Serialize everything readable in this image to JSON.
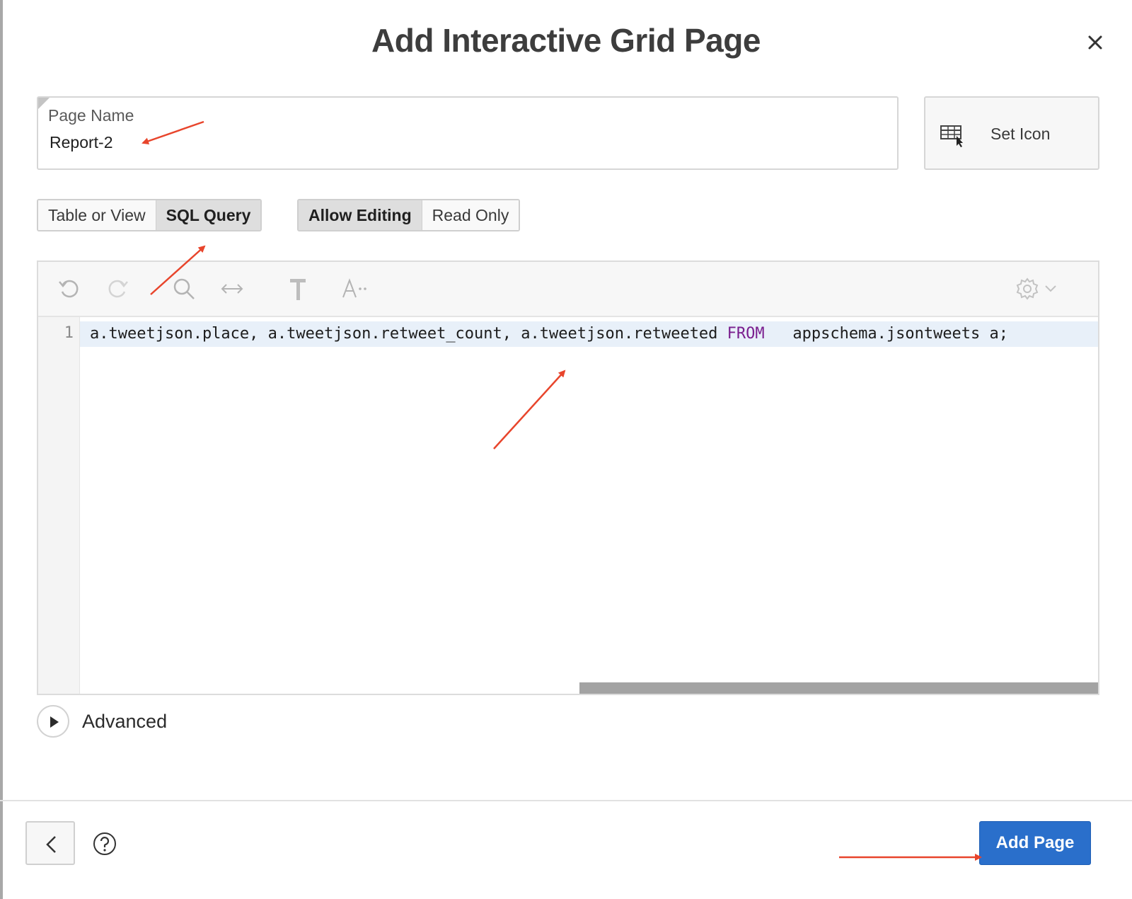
{
  "dialog": {
    "title": "Add Interactive Grid Page"
  },
  "page_name": {
    "label": "Page Name",
    "value": "Report-2"
  },
  "set_icon": {
    "label": "Set Icon"
  },
  "source_toggle": {
    "options": [
      "Table or View",
      "SQL Query"
    ],
    "selected": "SQL Query"
  },
  "edit_toggle": {
    "options": [
      "Allow Editing",
      "Read Only"
    ],
    "selected": "Allow Editing"
  },
  "editor": {
    "line_number": "1",
    "code_before_keyword": "a.tweetjson.place, a.tweetjson.retweet_count, a.tweetjson.retweeted ",
    "keyword": "FROM",
    "code_after_keyword": "   appschema.jsontweets a;",
    "keyword_color": "#7a1f8f",
    "toolbar_icons": [
      "undo-icon",
      "redo-icon",
      "search-icon",
      "transform-icon",
      "hammer-icon",
      "font-size-icon",
      "gear-icon"
    ]
  },
  "advanced": {
    "label": "Advanced",
    "expanded": false
  },
  "footer": {
    "add_page_label": "Add Page",
    "primary_color": "#2a6fcb"
  },
  "annotation_color": "#e8452c"
}
